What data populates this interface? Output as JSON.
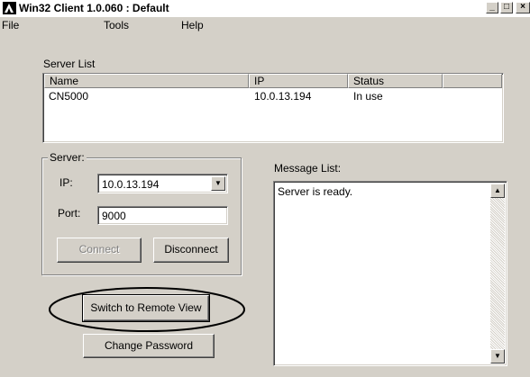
{
  "window": {
    "title": "Win32 Client 1.0.060 : Default",
    "minimize_icon": "_",
    "maximize_icon": "□",
    "close_icon": "×"
  },
  "menu": {
    "file": "File",
    "tools": "Tools",
    "help": "Help"
  },
  "server_list": {
    "label": "Server List",
    "columns": [
      "Name",
      "IP",
      "Status"
    ],
    "rows": [
      {
        "name": "CN5000",
        "ip": "10.0.13.194",
        "status": "In use"
      }
    ]
  },
  "server": {
    "group_label": "Server:",
    "ip_label": "IP:",
    "ip_value": "10.0.13.194",
    "port_label": "Port:",
    "port_value": "9000",
    "connect_label": "Connect",
    "disconnect_label": "Disconnect"
  },
  "actions": {
    "switch_label": "Switch to Remote View",
    "change_password_label": "Change Password"
  },
  "messages": {
    "label": "Message List:",
    "lines": [
      "Server is ready."
    ]
  },
  "colors": {
    "face": "#d4d0c8",
    "highlight_ellipse": "#000000"
  }
}
